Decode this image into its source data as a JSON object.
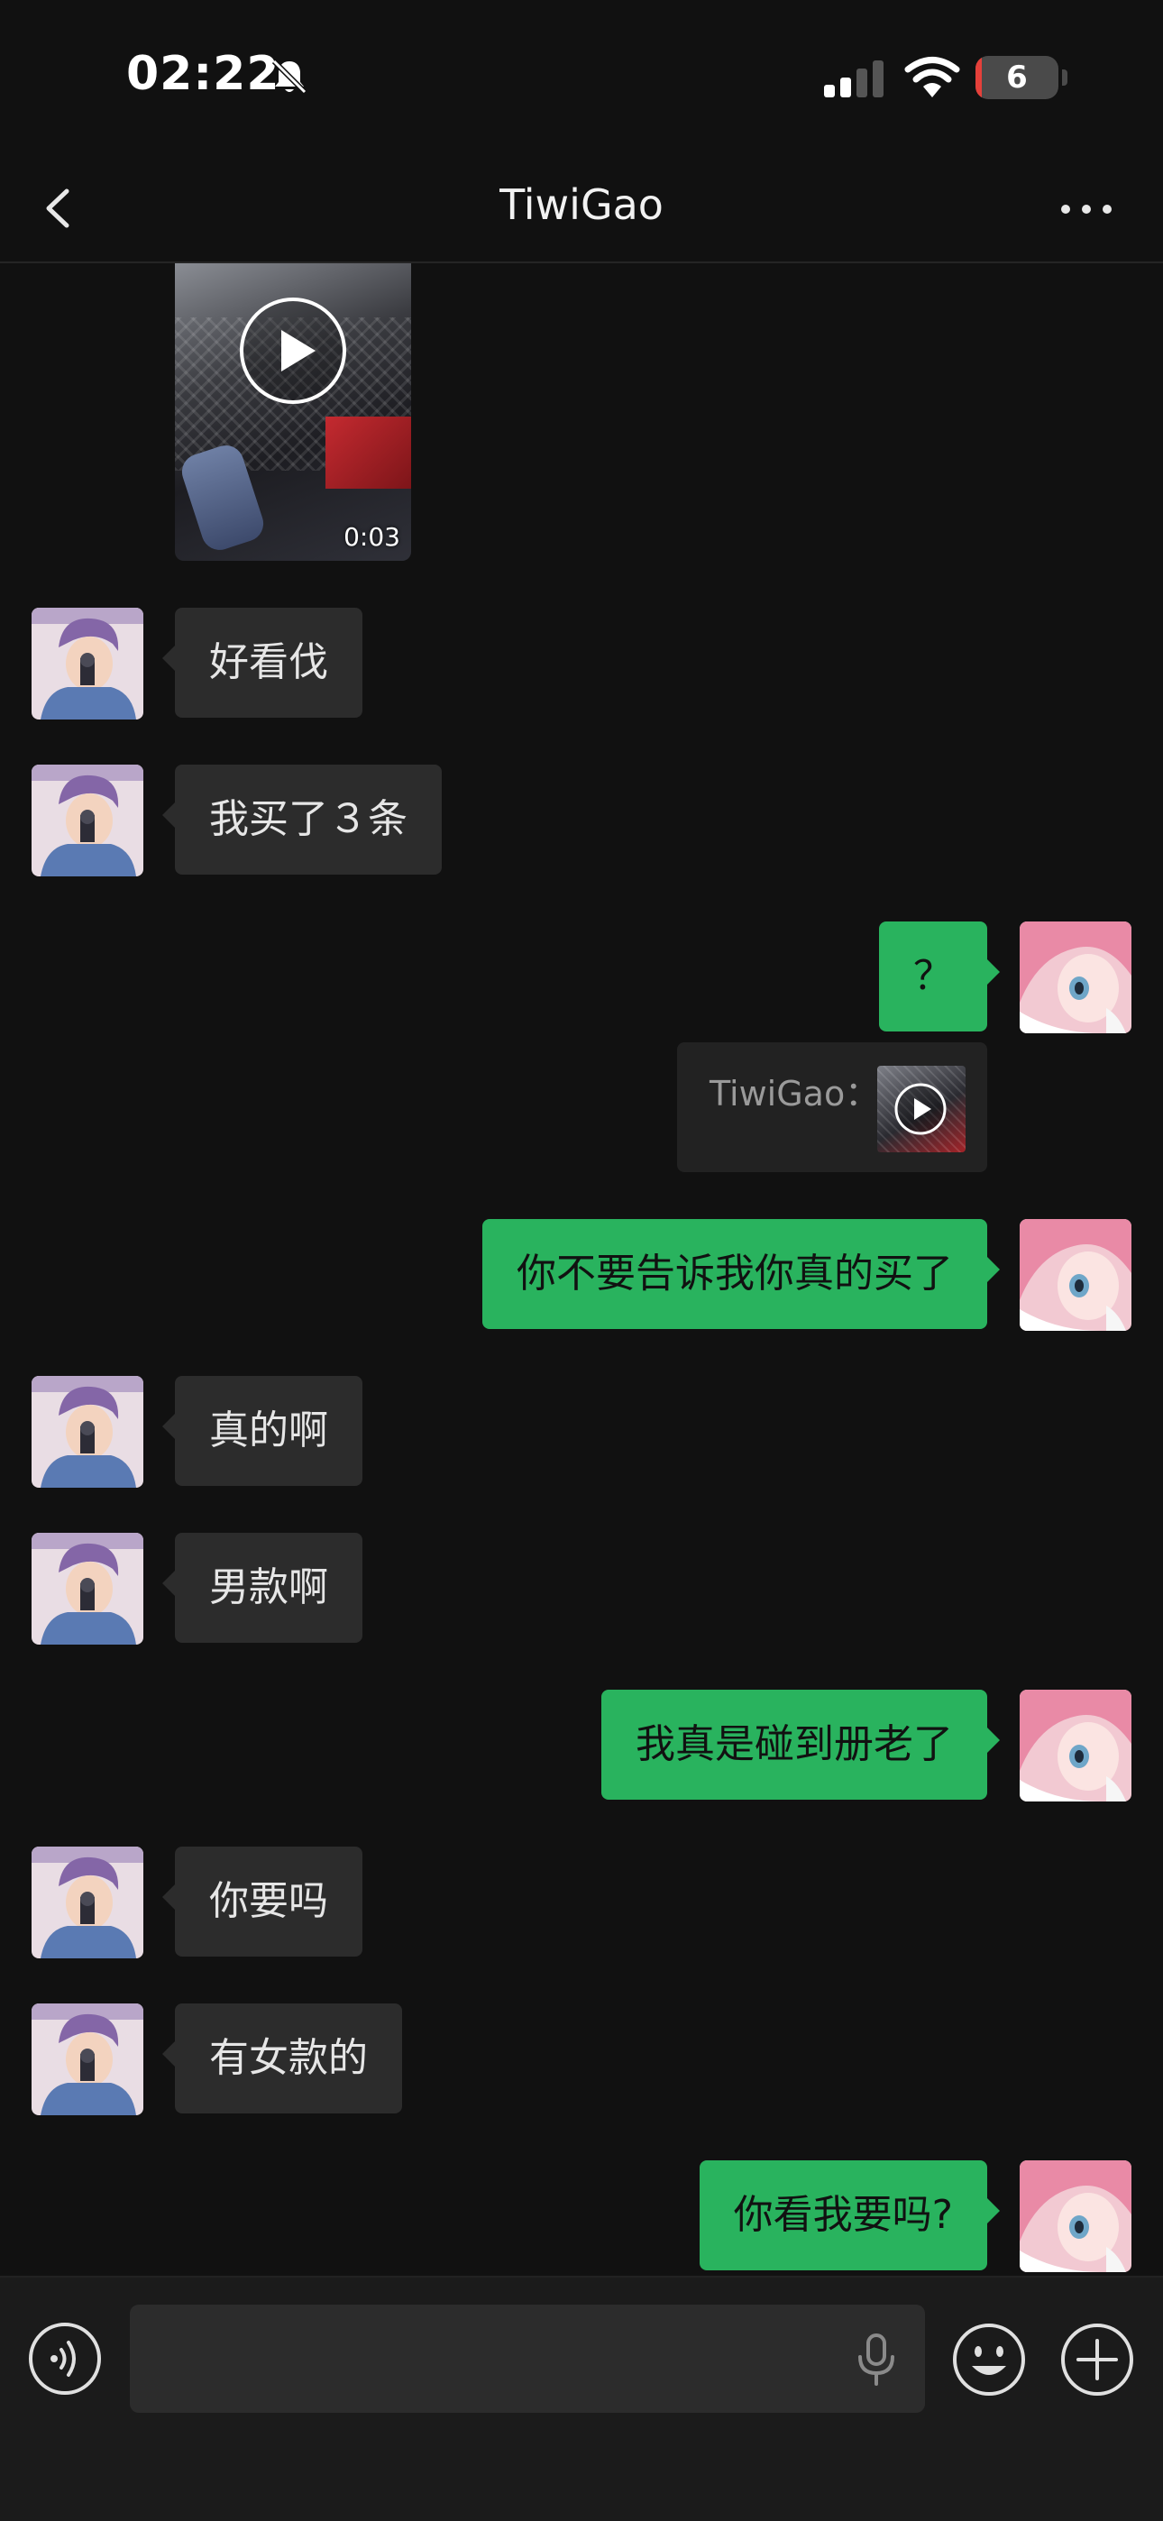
{
  "status_bar": {
    "time": "02:22",
    "battery_level": "6",
    "battery_fraction": 0.06,
    "icons": [
      "bell-slash-icon",
      "cellular-signal-icon",
      "wifi-icon",
      "battery-icon"
    ]
  },
  "nav": {
    "title": "TiwiGao",
    "back_icon": "chevron-left-icon",
    "more_icon": "ellipsis-icon"
  },
  "video": {
    "duration": "0:03",
    "play_icon": "play-icon"
  },
  "messages": [
    {
      "side": "in",
      "text": "好看伐"
    },
    {
      "side": "in",
      "text": "我买了３条"
    },
    {
      "side": "out",
      "text": "？"
    },
    {
      "side": "out",
      "quote": "TiwiGao："
    },
    {
      "side": "out",
      "text": "你不要告诉我你真的买了"
    },
    {
      "side": "in",
      "text": "真的啊"
    },
    {
      "side": "in",
      "text": "男款啊"
    },
    {
      "side": "out",
      "text": "我真是碰到册老了"
    },
    {
      "side": "in",
      "text": "你要吗"
    },
    {
      "side": "in",
      "text": "有女款的"
    },
    {
      "side": "out",
      "text": "你看我要吗?"
    }
  ],
  "input_bar": {
    "placeholder": "",
    "icons": [
      "voice-icon",
      "microphone-icon",
      "emoji-icon",
      "plus-icon"
    ]
  },
  "colors": {
    "background": "#111111",
    "incoming_bubble": "#2c2c2c",
    "outgoing_bubble": "#29b35e",
    "battery_low": "#e5403a"
  }
}
